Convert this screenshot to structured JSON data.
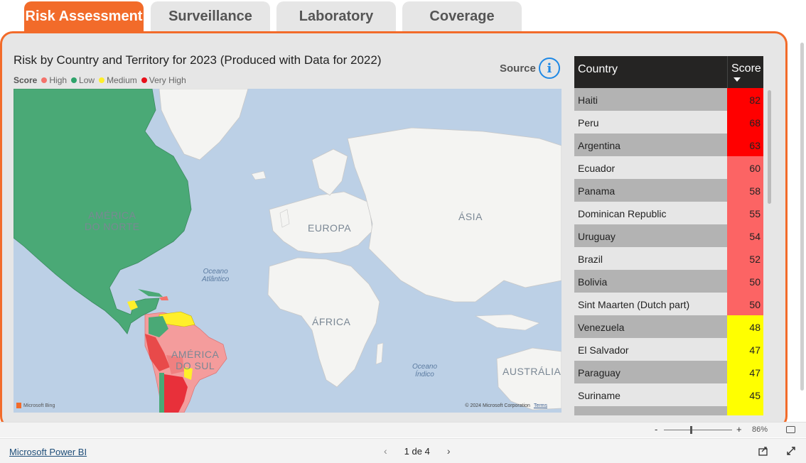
{
  "tabs": [
    {
      "label": "Risk Assessment",
      "active": true
    },
    {
      "label": "Surveillance",
      "active": false
    },
    {
      "label": "Laboratory",
      "active": false
    },
    {
      "label": "Coverage",
      "active": false
    }
  ],
  "visual": {
    "title": "Risk by Country and Territory for 2023 (Produced with Data for 2022)",
    "legend_title": "Score",
    "legend": [
      {
        "label": "High",
        "color": "#f4736b"
      },
      {
        "label": "Low",
        "color": "#2ea36a"
      },
      {
        "label": "Medium",
        "color": "#ffef2a"
      },
      {
        "label": "Very High",
        "color": "#e8101a"
      }
    ],
    "source_label": "Source",
    "info_icon": "i"
  },
  "map": {
    "labels": {
      "north_america": "AMÉRICA\nDO NORTE",
      "europe": "EUROPA",
      "asia": "ÁSIA",
      "africa": "ÁFRICA",
      "south_america": "AMÉRICA\nDO SUL",
      "australia": "AUSTRÁLIA",
      "atlantic": "Oceano\nAtlântico",
      "indian": "Oceano\nÍndico"
    },
    "bing": "Microsoft Bing",
    "copyright": "© 2024 Microsoft Corporation",
    "terms": "Terms"
  },
  "table": {
    "col_country": "Country",
    "col_score": "Score",
    "rows": [
      {
        "country": "Haiti",
        "score": "82",
        "color": "#ff0000"
      },
      {
        "country": "Peru",
        "score": "68",
        "color": "#ff0000"
      },
      {
        "country": "Argentina",
        "score": "63",
        "color": "#ff0000"
      },
      {
        "country": "Ecuador",
        "score": "60",
        "color": "#fc6464"
      },
      {
        "country": "Panama",
        "score": "58",
        "color": "#fc6464"
      },
      {
        "country": "Dominican Republic",
        "score": "55",
        "color": "#fc6464"
      },
      {
        "country": "Uruguay",
        "score": "54",
        "color": "#fc6464"
      },
      {
        "country": "Brazil",
        "score": "52",
        "color": "#fc6464"
      },
      {
        "country": "Bolivia",
        "score": "50",
        "color": "#fc6464"
      },
      {
        "country": "Sint Maarten (Dutch part)",
        "score": "50",
        "color": "#fc6464"
      },
      {
        "country": "Venezuela",
        "score": "48",
        "color": "#ffff00"
      },
      {
        "country": "El Salvador",
        "score": "47",
        "color": "#ffff00"
      },
      {
        "country": "Paraguay",
        "score": "47",
        "color": "#ffff00"
      },
      {
        "country": "Suriname",
        "score": "45",
        "color": "#ffff00"
      },
      {
        "country": "",
        "score": "",
        "color": "#ffff00"
      }
    ]
  },
  "zoom": {
    "minus": "-",
    "plus": "+",
    "percent": "86%",
    "level": 0.4
  },
  "footer": {
    "brand": "Microsoft Power BI",
    "page": "1 de 4",
    "prev": "‹",
    "next": "›"
  }
}
